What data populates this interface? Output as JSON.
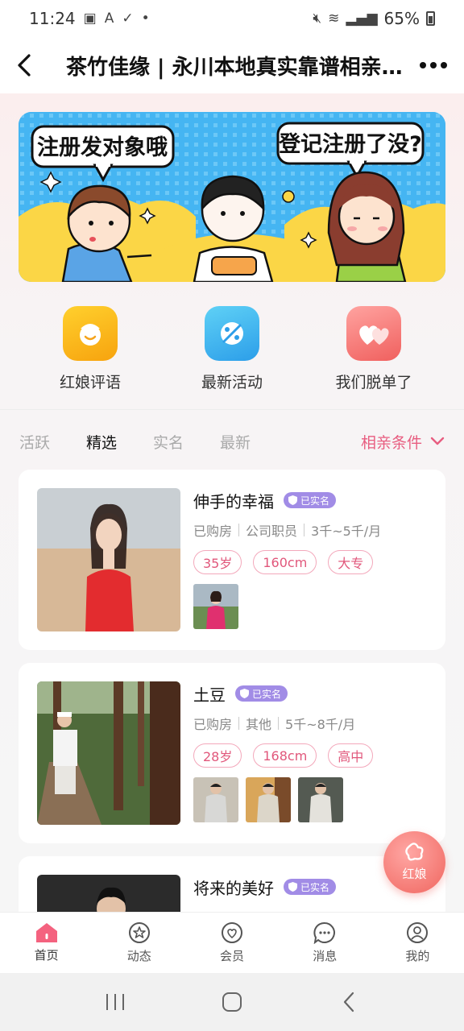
{
  "status_bar": {
    "time": "11:24",
    "battery": "65%"
  },
  "nav": {
    "title": "茶竹佳缘 | 永川本地真实靠谱相亲..."
  },
  "banner": {
    "left_bubble": "注册发对象哦",
    "right_bubble": "登记注册了没?"
  },
  "quick_links": [
    {
      "label": "红娘评语",
      "icon": "matchmaker-comment-icon"
    },
    {
      "label": "最新活动",
      "icon": "activity-icon"
    },
    {
      "label": "我们脱单了",
      "icon": "hearts-icon"
    }
  ],
  "tabs": [
    {
      "label": "活跃",
      "active": false
    },
    {
      "label": "精选",
      "active": true
    },
    {
      "label": "实名",
      "active": false
    },
    {
      "label": "最新",
      "active": false
    }
  ],
  "filter_label": "相亲条件",
  "verified_label": "已实名",
  "profiles": [
    {
      "name": "伸手的幸福",
      "meta": [
        "已购房",
        "公司职员",
        "3千~5千/月"
      ],
      "tags": [
        "35岁",
        "160cm",
        "大专"
      ],
      "thumb_count": 1
    },
    {
      "name": "土豆",
      "meta": [
        "已购房",
        "其他",
        "5千~8千/月"
      ],
      "tags": [
        "28岁",
        "168cm",
        "高中"
      ],
      "thumb_count": 3
    },
    {
      "name": "将来的美好",
      "meta": [],
      "tags": [],
      "thumb_count": 0
    }
  ],
  "fab_label": "红娘",
  "tabbar": [
    {
      "label": "首页",
      "icon": "home-icon",
      "active": true
    },
    {
      "label": "动态",
      "icon": "star-circle-icon",
      "active": false
    },
    {
      "label": "会员",
      "icon": "heart-circle-icon",
      "active": false
    },
    {
      "label": "消息",
      "icon": "chat-icon",
      "active": false
    },
    {
      "label": "我的",
      "icon": "user-icon",
      "active": false
    }
  ],
  "colors": {
    "accent": "#e85d80",
    "verified": "#a18ce6"
  }
}
